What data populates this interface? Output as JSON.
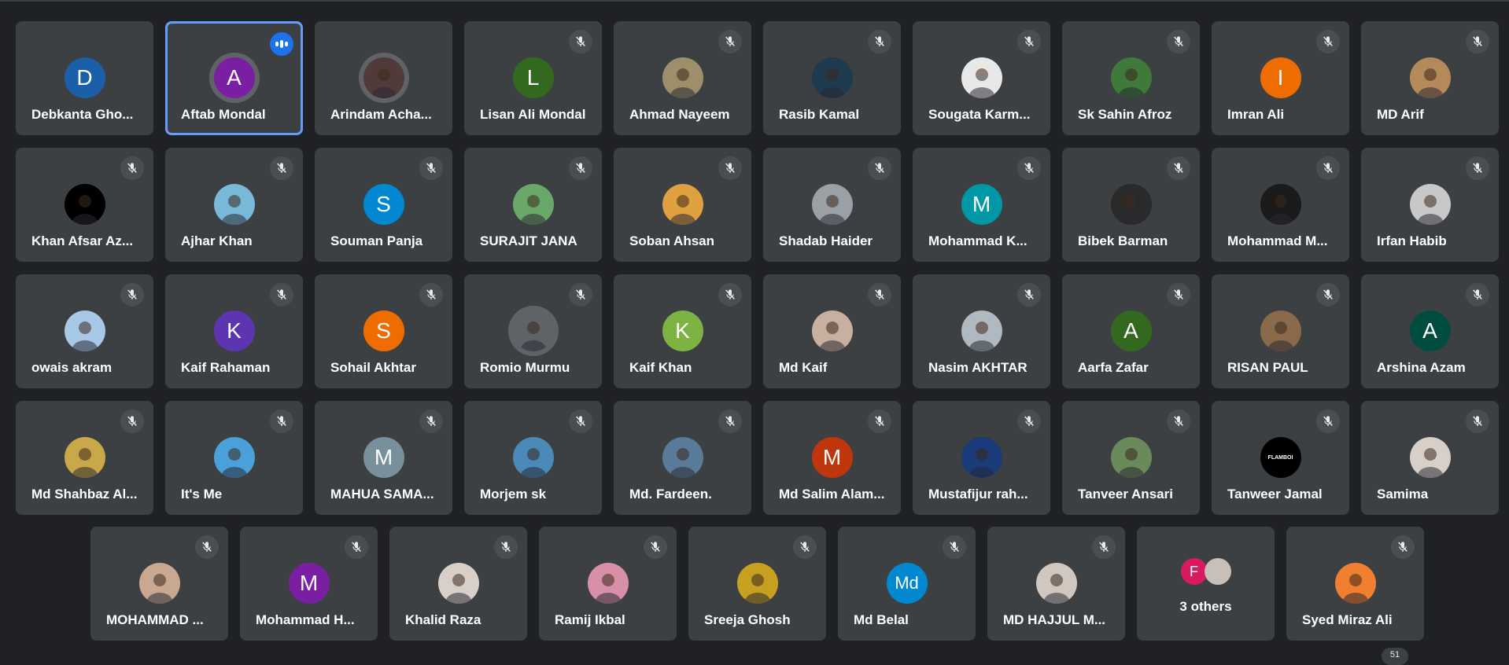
{
  "colors": {
    "background": "#202124",
    "tile": "#3c4043",
    "speaking_outline": "#669df6"
  },
  "participants": [
    {
      "name": "Debkanta Gho...",
      "initial": "D",
      "avatar_color": "#1a5fa8",
      "muted": false
    },
    {
      "name": "Aftab Mondal",
      "initial": "A",
      "avatar_color": "#7b1fa2",
      "speaking": true,
      "ring": true
    },
    {
      "name": "Arindam Acha...",
      "photo_color": "#503a3a",
      "muted": false,
      "ring": true
    },
    {
      "name": "Lisan Ali Mondal",
      "initial": "L",
      "avatar_color": "#33691e",
      "muted": true
    },
    {
      "name": "Ahmad Nayeem",
      "photo_color": "#9c8f6a",
      "muted": true
    },
    {
      "name": "Rasib Kamal",
      "photo_color": "#1d3a4e",
      "muted": true
    },
    {
      "name": "Sougata Karm...",
      "photo_color": "#e8e8e8",
      "muted": true
    },
    {
      "name": "Sk Sahin Afroz",
      "photo_color": "#3f7a3a",
      "muted": true
    },
    {
      "name": "Imran Ali",
      "initial": "I",
      "avatar_color": "#ef6c00",
      "muted": true
    },
    {
      "name": "MD Arif",
      "photo_color": "#b58a5a",
      "muted": true
    },
    {
      "name": "Khan Afsar Az...",
      "photo_color": "#000000",
      "muted": true
    },
    {
      "name": "Ajhar Khan",
      "photo_color": "#7ab8d8",
      "muted": true
    },
    {
      "name": "Souman Panja",
      "initial": "S",
      "avatar_color": "#0288d1",
      "muted": true
    },
    {
      "name": "SURAJIT JANA",
      "photo_color": "#6aa86a",
      "muted": true
    },
    {
      "name": "Soban Ahsan",
      "photo_color": "#e0a040",
      "muted": true
    },
    {
      "name": "Shadab Haider",
      "photo_color": "#9aa0a6",
      "muted": true
    },
    {
      "name": "Mohammad K...",
      "initial": "M",
      "avatar_color": "#0097a7",
      "muted": true
    },
    {
      "name": "Bibek Barman",
      "photo_color": "#2a2a2a",
      "muted": true
    },
    {
      "name": "Mohammad M...",
      "photo_color": "#1a1a1a",
      "muted": true
    },
    {
      "name": "Irfan Habib",
      "photo_color": "#c8c8c8",
      "muted": true
    },
    {
      "name": "owais akram",
      "photo_color": "#a8c8e8",
      "muted": true
    },
    {
      "name": "Kaif Rahaman",
      "initial": "K",
      "avatar_color": "#5e35b1",
      "muted": true
    },
    {
      "name": "Sohail Akhtar",
      "initial": "S",
      "avatar_color": "#ef6c00",
      "muted": true
    },
    {
      "name": "Romio Murmu",
      "photo_color": "#5f6368",
      "muted": true,
      "ring": true
    },
    {
      "name": "Kaif Khan",
      "initial": "K",
      "avatar_color": "#7cb342",
      "muted": true
    },
    {
      "name": "Md Kaif",
      "photo_color": "#c8b0a0",
      "muted": true
    },
    {
      "name": "Nasim AKHTAR",
      "photo_color": "#b0b8c0",
      "muted": true
    },
    {
      "name": "Aarfa Zafar",
      "initial": "A",
      "avatar_color": "#33691e",
      "muted": true
    },
    {
      "name": "RISAN PAUL",
      "photo_color": "#8a6a4a",
      "muted": true
    },
    {
      "name": "Arshina Azam",
      "initial": "A",
      "avatar_color": "#004d40",
      "muted": true
    },
    {
      "name": "Md Shahbaz Al...",
      "photo_color": "#c8a848",
      "muted": true
    },
    {
      "name": "It's Me",
      "photo_color": "#4aa0d8",
      "muted": true
    },
    {
      "name": "MAHUA SAMA...",
      "initial": "M",
      "avatar_color": "#78909c",
      "muted": true
    },
    {
      "name": "Morjem sk",
      "photo_color": "#4a8ab8",
      "muted": true
    },
    {
      "name": "Md. Fardeen.",
      "photo_color": "#5a7a9a",
      "muted": true
    },
    {
      "name": "Md Salim Alam...",
      "initial": "M",
      "avatar_color": "#bf360c",
      "muted": true
    },
    {
      "name": "Mustafijur rah...",
      "photo_color": "#1a3a7a",
      "muted": true
    },
    {
      "name": "Tanveer Ansari",
      "photo_color": "#6a8a5a",
      "muted": true
    },
    {
      "name": "Tanweer Jamal",
      "photo_color": "#000000",
      "muted": true,
      "photo_text": "FLAMBOI"
    },
    {
      "name": "Samima",
      "photo_color": "#d8d0c8",
      "muted": true
    },
    {
      "name": "MOHAMMAD ...",
      "photo_color": "#c8a890",
      "muted": true
    },
    {
      "name": "Mohammad H...",
      "initial": "M",
      "avatar_color": "#7b1fa2",
      "muted": true
    },
    {
      "name": "Khalid Raza",
      "photo_color": "#d8d0c8",
      "muted": true
    },
    {
      "name": "Ramij Ikbal",
      "photo_color": "#d890a8",
      "muted": true
    },
    {
      "name": "Sreeja Ghosh",
      "photo_color": "#c8a020",
      "muted": true
    },
    {
      "name": "Md Belal",
      "initial": "Md",
      "avatar_color": "#0288d1",
      "muted": true
    },
    {
      "name": "MD HAJJUL M...",
      "photo_color": "#d0c8c0",
      "muted": true
    },
    {
      "others": true,
      "label": "3 others",
      "initial": "F",
      "avatar_color": "#d81b60",
      "photo_color": "#c8c0b8"
    },
    {
      "name": "Syed Miraz Ali",
      "photo_color": "#f08030",
      "muted": true
    }
  ],
  "participant_count": "51"
}
